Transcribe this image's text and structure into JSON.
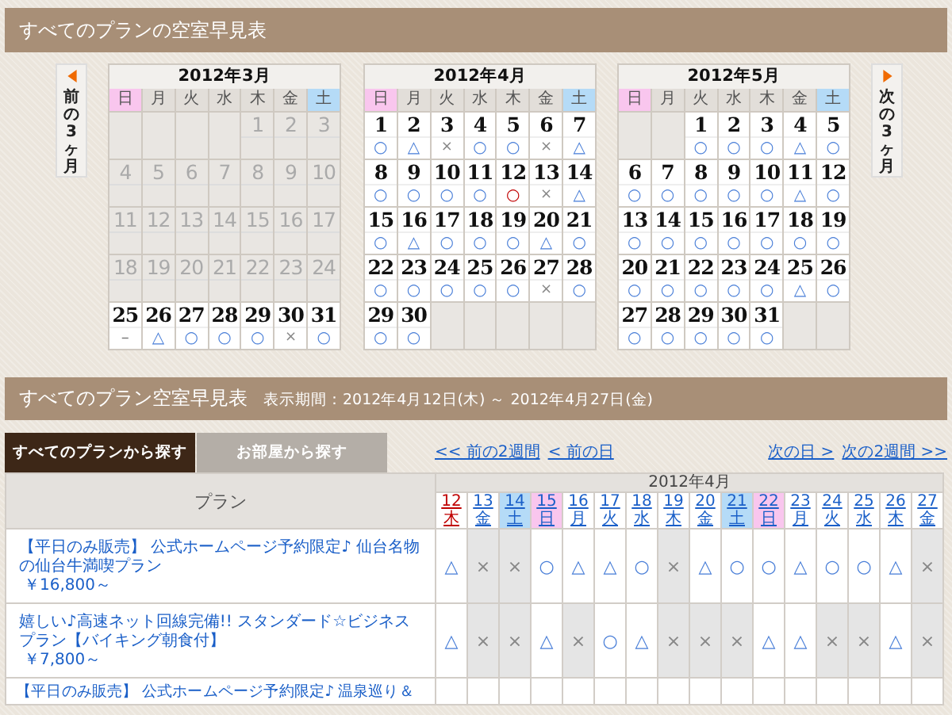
{
  "calendar_panel": {
    "title": "すべてのプランの空室早見表",
    "prev_button": {
      "label": "前の3ヶ月"
    },
    "next_button": {
      "label": "次の3ヶ月"
    },
    "months": [
      {
        "title": "2012年3月",
        "weekdays": [
          {
            "label": "日",
            "kind": "sun"
          },
          {
            "label": "月",
            "kind": "day"
          },
          {
            "label": "火",
            "kind": "day"
          },
          {
            "label": "水",
            "kind": "day"
          },
          {
            "label": "木",
            "kind": "day"
          },
          {
            "label": "金",
            "kind": "day"
          },
          {
            "label": "土",
            "kind": "sat"
          }
        ],
        "weeks": [
          [
            {
              "kind": "empty"
            },
            {
              "kind": "empty"
            },
            {
              "kind": "empty"
            },
            {
              "kind": "empty"
            },
            {
              "kind": "past",
              "day": "1"
            },
            {
              "kind": "past",
              "day": "2"
            },
            {
              "kind": "past",
              "day": "3"
            }
          ],
          [
            {
              "kind": "past",
              "day": "4"
            },
            {
              "kind": "past",
              "day": "5"
            },
            {
              "kind": "past",
              "day": "6"
            },
            {
              "kind": "past",
              "day": "7"
            },
            {
              "kind": "past",
              "day": "8"
            },
            {
              "kind": "past",
              "day": "9"
            },
            {
              "kind": "past",
              "day": "10"
            }
          ],
          [
            {
              "kind": "past",
              "day": "11"
            },
            {
              "kind": "past",
              "day": "12"
            },
            {
              "kind": "past",
              "day": "13"
            },
            {
              "kind": "past",
              "day": "14"
            },
            {
              "kind": "past",
              "day": "15"
            },
            {
              "kind": "past",
              "day": "16"
            },
            {
              "kind": "past",
              "day": "17"
            }
          ],
          [
            {
              "kind": "past",
              "day": "18"
            },
            {
              "kind": "past",
              "day": "19"
            },
            {
              "kind": "past",
              "day": "20"
            },
            {
              "kind": "past",
              "day": "21"
            },
            {
              "kind": "past",
              "day": "22"
            },
            {
              "kind": "past",
              "day": "23"
            },
            {
              "kind": "past",
              "day": "24"
            }
          ],
          [
            {
              "kind": "open",
              "day": "25",
              "mark": {
                "text": "–",
                "kind": "none"
              }
            },
            {
              "kind": "open",
              "day": "26",
              "mark": {
                "text": "△",
                "kind": "few"
              }
            },
            {
              "kind": "open",
              "day": "27",
              "mark": {
                "text": "○",
                "kind": "vacant"
              }
            },
            {
              "kind": "open",
              "day": "28",
              "mark": {
                "text": "○",
                "kind": "vacant"
              }
            },
            {
              "kind": "open",
              "day": "29",
              "mark": {
                "text": "○",
                "kind": "vacant"
              }
            },
            {
              "kind": "open",
              "day": "30",
              "mark": {
                "text": "×",
                "kind": "full"
              }
            },
            {
              "kind": "open",
              "day": "31",
              "mark": {
                "text": "○",
                "kind": "vacant"
              }
            }
          ]
        ]
      },
      {
        "title": "2012年4月",
        "weekdays": [
          {
            "label": "日",
            "kind": "sun"
          },
          {
            "label": "月",
            "kind": "day"
          },
          {
            "label": "火",
            "kind": "day"
          },
          {
            "label": "水",
            "kind": "day"
          },
          {
            "label": "木",
            "kind": "day"
          },
          {
            "label": "金",
            "kind": "day"
          },
          {
            "label": "土",
            "kind": "sat"
          }
        ],
        "weeks": [
          [
            {
              "kind": "open",
              "day": "1",
              "mark": {
                "text": "○",
                "kind": "vacant"
              }
            },
            {
              "kind": "open",
              "day": "2",
              "mark": {
                "text": "△",
                "kind": "few"
              }
            },
            {
              "kind": "open",
              "day": "3",
              "mark": {
                "text": "×",
                "kind": "full"
              }
            },
            {
              "kind": "open",
              "day": "4",
              "mark": {
                "text": "○",
                "kind": "vacant"
              }
            },
            {
              "kind": "open",
              "day": "5",
              "mark": {
                "text": "○",
                "kind": "vacant"
              }
            },
            {
              "kind": "open",
              "day": "6",
              "mark": {
                "text": "×",
                "kind": "full"
              }
            },
            {
              "kind": "open",
              "day": "7",
              "mark": {
                "text": "△",
                "kind": "few"
              }
            }
          ],
          [
            {
              "kind": "open",
              "day": "8",
              "mark": {
                "text": "○",
                "kind": "vacant"
              }
            },
            {
              "kind": "open",
              "day": "9",
              "mark": {
                "text": "○",
                "kind": "vacant"
              }
            },
            {
              "kind": "open",
              "day": "10",
              "mark": {
                "text": "○",
                "kind": "vacant"
              }
            },
            {
              "kind": "open",
              "day": "11",
              "mark": {
                "text": "○",
                "kind": "vacant"
              }
            },
            {
              "kind": "today",
              "day": "12",
              "mark": {
                "text": "○",
                "kind": "vacant"
              }
            },
            {
              "kind": "open",
              "day": "13",
              "mark": {
                "text": "×",
                "kind": "full"
              }
            },
            {
              "kind": "open",
              "day": "14",
              "mark": {
                "text": "△",
                "kind": "few"
              }
            }
          ],
          [
            {
              "kind": "open",
              "day": "15",
              "mark": {
                "text": "○",
                "kind": "vacant"
              }
            },
            {
              "kind": "open",
              "day": "16",
              "mark": {
                "text": "△",
                "kind": "few"
              }
            },
            {
              "kind": "open",
              "day": "17",
              "mark": {
                "text": "○",
                "kind": "vacant"
              }
            },
            {
              "kind": "open",
              "day": "18",
              "mark": {
                "text": "○",
                "kind": "vacant"
              }
            },
            {
              "kind": "open",
              "day": "19",
              "mark": {
                "text": "○",
                "kind": "vacant"
              }
            },
            {
              "kind": "open",
              "day": "20",
              "mark": {
                "text": "△",
                "kind": "few"
              }
            },
            {
              "kind": "open",
              "day": "21",
              "mark": {
                "text": "○",
                "kind": "vacant"
              }
            }
          ],
          [
            {
              "kind": "open",
              "day": "22",
              "mark": {
                "text": "○",
                "kind": "vacant"
              }
            },
            {
              "kind": "open",
              "day": "23",
              "mark": {
                "text": "○",
                "kind": "vacant"
              }
            },
            {
              "kind": "open",
              "day": "24",
              "mark": {
                "text": "○",
                "kind": "vacant"
              }
            },
            {
              "kind": "open",
              "day": "25",
              "mark": {
                "text": "○",
                "kind": "vacant"
              }
            },
            {
              "kind": "open",
              "day": "26",
              "mark": {
                "text": "○",
                "kind": "vacant"
              }
            },
            {
              "kind": "open",
              "day": "27",
              "mark": {
                "text": "×",
                "kind": "full"
              }
            },
            {
              "kind": "open",
              "day": "28",
              "mark": {
                "text": "○",
                "kind": "vacant"
              }
            }
          ],
          [
            {
              "kind": "open",
              "day": "29",
              "mark": {
                "text": "○",
                "kind": "vacant"
              }
            },
            {
              "kind": "open",
              "day": "30",
              "mark": {
                "text": "○",
                "kind": "vacant"
              }
            },
            {
              "kind": "empty"
            },
            {
              "kind": "empty"
            },
            {
              "kind": "empty"
            },
            {
              "kind": "empty"
            },
            {
              "kind": "empty"
            }
          ]
        ]
      },
      {
        "title": "2012年5月",
        "weekdays": [
          {
            "label": "日",
            "kind": "sun"
          },
          {
            "label": "月",
            "kind": "day"
          },
          {
            "label": "火",
            "kind": "day"
          },
          {
            "label": "水",
            "kind": "day"
          },
          {
            "label": "木",
            "kind": "day"
          },
          {
            "label": "金",
            "kind": "day"
          },
          {
            "label": "土",
            "kind": "sat"
          }
        ],
        "weeks": [
          [
            {
              "kind": "empty"
            },
            {
              "kind": "empty"
            },
            {
              "kind": "open",
              "day": "1",
              "mark": {
                "text": "○",
                "kind": "vacant"
              }
            },
            {
              "kind": "open",
              "day": "2",
              "mark": {
                "text": "○",
                "kind": "vacant"
              }
            },
            {
              "kind": "open",
              "day": "3",
              "mark": {
                "text": "○",
                "kind": "vacant"
              }
            },
            {
              "kind": "open",
              "day": "4",
              "mark": {
                "text": "△",
                "kind": "few"
              }
            },
            {
              "kind": "open",
              "day": "5",
              "mark": {
                "text": "○",
                "kind": "vacant"
              }
            }
          ],
          [
            {
              "kind": "open",
              "day": "6",
              "mark": {
                "text": "○",
                "kind": "vacant"
              }
            },
            {
              "kind": "open",
              "day": "7",
              "mark": {
                "text": "○",
                "kind": "vacant"
              }
            },
            {
              "kind": "open",
              "day": "8",
              "mark": {
                "text": "○",
                "kind": "vacant"
              }
            },
            {
              "kind": "open",
              "day": "9",
              "mark": {
                "text": "○",
                "kind": "vacant"
              }
            },
            {
              "kind": "open",
              "day": "10",
              "mark": {
                "text": "○",
                "kind": "vacant"
              }
            },
            {
              "kind": "open",
              "day": "11",
              "mark": {
                "text": "△",
                "kind": "few"
              }
            },
            {
              "kind": "open",
              "day": "12",
              "mark": {
                "text": "○",
                "kind": "vacant"
              }
            }
          ],
          [
            {
              "kind": "open",
              "day": "13",
              "mark": {
                "text": "○",
                "kind": "vacant"
              }
            },
            {
              "kind": "open",
              "day": "14",
              "mark": {
                "text": "○",
                "kind": "vacant"
              }
            },
            {
              "kind": "open",
              "day": "15",
              "mark": {
                "text": "○",
                "kind": "vacant"
              }
            },
            {
              "kind": "open",
              "day": "16",
              "mark": {
                "text": "○",
                "kind": "vacant"
              }
            },
            {
              "kind": "open",
              "day": "17",
              "mark": {
                "text": "○",
                "kind": "vacant"
              }
            },
            {
              "kind": "open",
              "day": "18",
              "mark": {
                "text": "○",
                "kind": "vacant"
              }
            },
            {
              "kind": "open",
              "day": "19",
              "mark": {
                "text": "○",
                "kind": "vacant"
              }
            }
          ],
          [
            {
              "kind": "open",
              "day": "20",
              "mark": {
                "text": "○",
                "kind": "vacant"
              }
            },
            {
              "kind": "open",
              "day": "21",
              "mark": {
                "text": "○",
                "kind": "vacant"
              }
            },
            {
              "kind": "open",
              "day": "22",
              "mark": {
                "text": "○",
                "kind": "vacant"
              }
            },
            {
              "kind": "open",
              "day": "23",
              "mark": {
                "text": "○",
                "kind": "vacant"
              }
            },
            {
              "kind": "open",
              "day": "24",
              "mark": {
                "text": "○",
                "kind": "vacant"
              }
            },
            {
              "kind": "open",
              "day": "25",
              "mark": {
                "text": "△",
                "kind": "few"
              }
            },
            {
              "kind": "open",
              "day": "26",
              "mark": {
                "text": "○",
                "kind": "vacant"
              }
            }
          ],
          [
            {
              "kind": "open",
              "day": "27",
              "mark": {
                "text": "○",
                "kind": "vacant"
              }
            },
            {
              "kind": "open",
              "day": "28",
              "mark": {
                "text": "○",
                "kind": "vacant"
              }
            },
            {
              "kind": "open",
              "day": "29",
              "mark": {
                "text": "○",
                "kind": "vacant"
              }
            },
            {
              "kind": "open",
              "day": "30",
              "mark": {
                "text": "○",
                "kind": "vacant"
              }
            },
            {
              "kind": "open",
              "day": "31",
              "mark": {
                "text": "○",
                "kind": "vacant"
              }
            },
            {
              "kind": "empty"
            },
            {
              "kind": "empty"
            }
          ]
        ]
      }
    ]
  },
  "plan_panel": {
    "title": "すべてのプラン空室早見表",
    "period": "表示期間：2012年4月12日(木) ～ 2012年4月27日(金)",
    "tabs": [
      {
        "label": "すべてのプランから探す",
        "selected": true
      },
      {
        "label": "お部屋から探す",
        "selected": false
      }
    ],
    "prev_links": [
      "<< 前の2週間",
      "< 前の日"
    ],
    "next_links": [
      "次の日 >",
      "次の2週間 >>"
    ],
    "table": {
      "plan_header": "プラン",
      "month": "2012年4月",
      "dates": [
        {
          "day": "12",
          "weekday": "木",
          "kind": "today"
        },
        {
          "day": "13",
          "weekday": "金",
          "kind": "day"
        },
        {
          "day": "14",
          "weekday": "土",
          "kind": "sat"
        },
        {
          "day": "15",
          "weekday": "日",
          "kind": "sun"
        },
        {
          "day": "16",
          "weekday": "月",
          "kind": "day"
        },
        {
          "day": "17",
          "weekday": "火",
          "kind": "day"
        },
        {
          "day": "18",
          "weekday": "水",
          "kind": "day"
        },
        {
          "day": "19",
          "weekday": "木",
          "kind": "day"
        },
        {
          "day": "20",
          "weekday": "金",
          "kind": "day"
        },
        {
          "day": "21",
          "weekday": "土",
          "kind": "sat"
        },
        {
          "day": "22",
          "weekday": "日",
          "kind": "sun"
        },
        {
          "day": "23",
          "weekday": "月",
          "kind": "day"
        },
        {
          "day": "24",
          "weekday": "火",
          "kind": "day"
        },
        {
          "day": "25",
          "weekday": "水",
          "kind": "day"
        },
        {
          "day": "26",
          "weekday": "木",
          "kind": "day"
        },
        {
          "day": "27",
          "weekday": "金",
          "kind": "day"
        }
      ],
      "rows": [
        {
          "name": "【平日のみ販売】 公式ホームページ予約限定♪ 仙台名物の仙台牛満喫プラン",
          "price": "￥16,800～",
          "cells": [
            {
              "mark": "△",
              "kind": "few"
            },
            {
              "mark": "×",
              "kind": "full"
            },
            {
              "mark": "×",
              "kind": "full"
            },
            {
              "mark": "○",
              "kind": "vacant"
            },
            {
              "mark": "△",
              "kind": "few"
            },
            {
              "mark": "△",
              "kind": "few"
            },
            {
              "mark": "○",
              "kind": "vacant"
            },
            {
              "mark": "×",
              "kind": "full"
            },
            {
              "mark": "△",
              "kind": "few"
            },
            {
              "mark": "○",
              "kind": "vacant"
            },
            {
              "mark": "○",
              "kind": "vacant"
            },
            {
              "mark": "△",
              "kind": "few"
            },
            {
              "mark": "○",
              "kind": "vacant"
            },
            {
              "mark": "○",
              "kind": "vacant"
            },
            {
              "mark": "△",
              "kind": "few"
            },
            {
              "mark": "×",
              "kind": "full"
            }
          ]
        },
        {
          "name": "嬉しい♪高速ネット回線完備!! スタンダード☆ビジネスプラン【バイキング朝食付】",
          "price": "￥7,800～",
          "cells": [
            {
              "mark": "△",
              "kind": "few"
            },
            {
              "mark": "×",
              "kind": "full"
            },
            {
              "mark": "×",
              "kind": "full"
            },
            {
              "mark": "△",
              "kind": "few"
            },
            {
              "mark": "×",
              "kind": "full"
            },
            {
              "mark": "○",
              "kind": "vacant"
            },
            {
              "mark": "△",
              "kind": "few"
            },
            {
              "mark": "×",
              "kind": "full"
            },
            {
              "mark": "×",
              "kind": "full"
            },
            {
              "mark": "×",
              "kind": "full"
            },
            {
              "mark": "△",
              "kind": "few"
            },
            {
              "mark": "△",
              "kind": "few"
            },
            {
              "mark": "×",
              "kind": "full"
            },
            {
              "mark": "×",
              "kind": "full"
            },
            {
              "mark": "△",
              "kind": "few"
            },
            {
              "mark": "×",
              "kind": "full"
            }
          ]
        },
        {
          "name": "【平日のみ販売】 公式ホームページ予約限定♪ 温泉巡り＆"
        }
      ]
    }
  }
}
